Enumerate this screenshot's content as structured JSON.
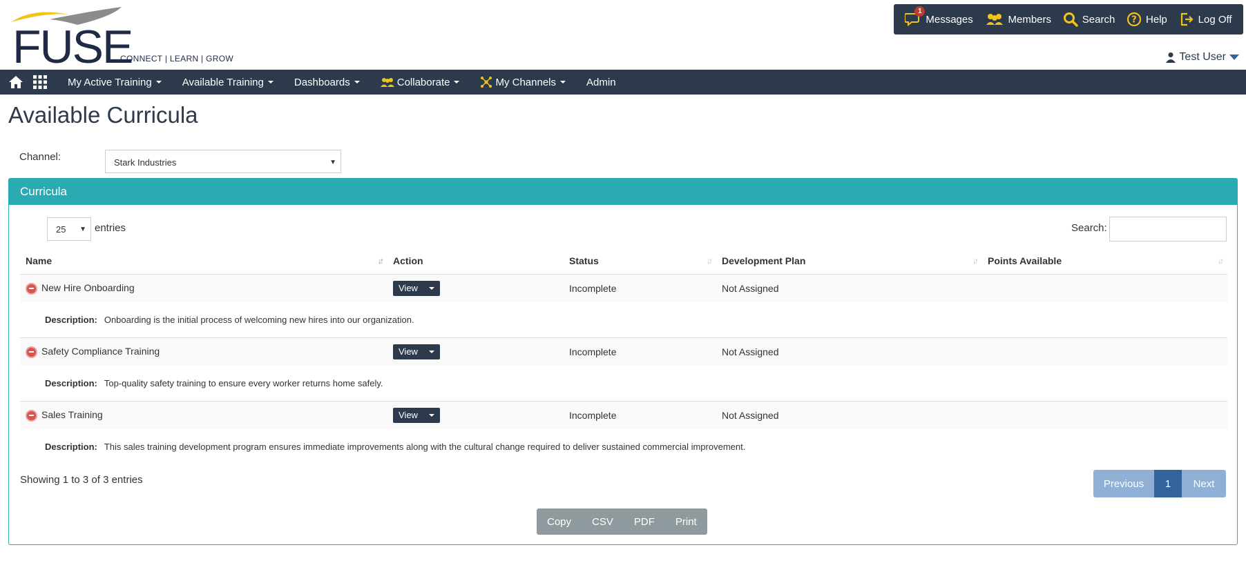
{
  "brand": {
    "logo_text": "FUSE",
    "tagline": "CONNECT | LEARN | GROW",
    "colors": {
      "navy": "#2c3a4b",
      "teal": "#2aabb2",
      "accent_yellow": "#f0c419"
    }
  },
  "topbar": {
    "items": [
      {
        "label": "Messages",
        "icon": "messages-icon",
        "badge": "1"
      },
      {
        "label": "Members",
        "icon": "members-icon"
      },
      {
        "label": "Search",
        "icon": "search-icon"
      },
      {
        "label": "Help",
        "icon": "help-icon"
      },
      {
        "label": "Log Off",
        "icon": "log-off-icon"
      }
    ]
  },
  "user": {
    "name": "Test User"
  },
  "nav": {
    "items": [
      {
        "label": "My Active Training"
      },
      {
        "label": "Available Training"
      },
      {
        "label": "Dashboards"
      },
      {
        "label": "Collaborate"
      },
      {
        "label": "My Channels"
      },
      {
        "label": "Admin"
      }
    ]
  },
  "page": {
    "title": "Available Curricula",
    "channel_label": "Channel:",
    "channel_value": "Stark Industries"
  },
  "panel": {
    "title": "Curricula",
    "length_value": "25",
    "length_label": "entries",
    "search_label": "Search:",
    "columns": [
      "Name",
      "Action",
      "Status",
      "Development Plan",
      "Points Available"
    ],
    "rows": [
      {
        "name": "New Hire Onboarding",
        "action": "View",
        "status": "Incomplete",
        "plan": "Not Assigned",
        "points": "",
        "desc_label": "Description:",
        "description": "Onboarding is the initial process of welcoming new hires into our organization."
      },
      {
        "name": "Safety Compliance Training",
        "action": "View",
        "status": "Incomplete",
        "plan": "Not Assigned",
        "points": "",
        "desc_label": "Description:",
        "description": "Top-quality safety training to ensure every worker returns home safely."
      },
      {
        "name": "Sales Training",
        "action": "View",
        "status": "Incomplete",
        "plan": "Not Assigned",
        "points": "",
        "desc_label": "Description:",
        "description": "This sales training development program ensures immediate improvements along with the cultural change required to deliver sustained commercial improvement."
      }
    ],
    "info": "Showing 1 to 3 of 3 entries",
    "pager": {
      "previous": "Previous",
      "current": "1",
      "next": "Next"
    },
    "export": [
      "Copy",
      "CSV",
      "PDF",
      "Print"
    ]
  }
}
